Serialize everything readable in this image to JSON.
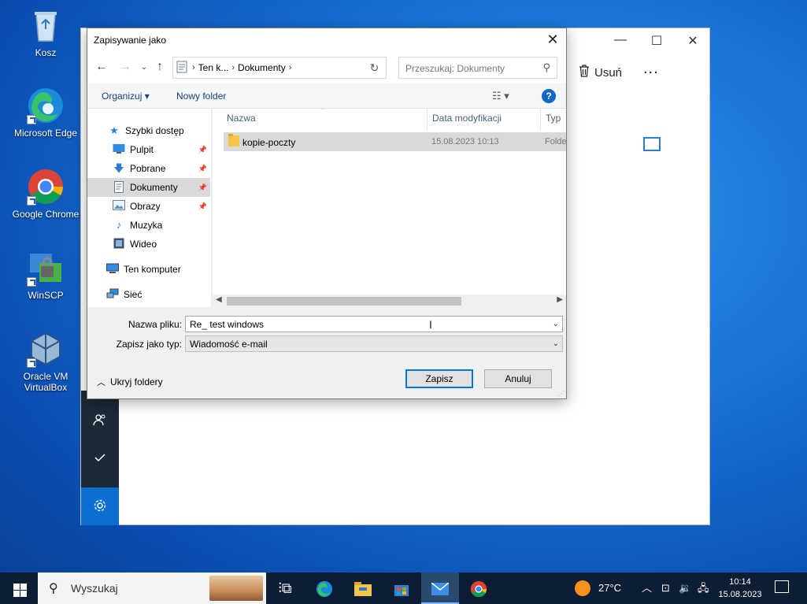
{
  "desktop": {
    "icons": [
      {
        "label": "Kosz"
      },
      {
        "label": "Microsoft Edge"
      },
      {
        "label": "Google Chrome"
      },
      {
        "label": "WinSCP"
      },
      {
        "label": "Oracle VM VirtualBox"
      }
    ]
  },
  "mail_window": {
    "delete_label": "Usuń",
    "more_label": "..."
  },
  "dialog": {
    "title": "Zapisywanie jako",
    "breadcrumb": [
      "Ten k...",
      "Dokumenty"
    ],
    "search_placeholder": "Przeszukaj: Dokumenty",
    "toolbar": {
      "organize": "Organizuj",
      "new_folder": "Nowy folder",
      "help": "?"
    },
    "nav_pane": {
      "quick_access": "Szybki dostęp",
      "items": [
        {
          "label": "Pulpit"
        },
        {
          "label": "Pobrane"
        },
        {
          "label": "Dokumenty"
        },
        {
          "label": "Obrazy"
        },
        {
          "label": "Muzyka"
        },
        {
          "label": "Wideo"
        }
      ],
      "this_pc": "Ten komputer",
      "network": "Sieć"
    },
    "columns": {
      "name": "Nazwa",
      "date": "Data modyfikacji",
      "type": "Typ"
    },
    "files": [
      {
        "name": "kopie-poczty",
        "date": "15.08.2023 10:13",
        "type": "Folde"
      }
    ],
    "filename_label": "Nazwa pliku:",
    "filename_value": "Re_ test windows",
    "filetype_label": "Zapisz jako typ:",
    "filetype_value": "Wiadomość e-mail",
    "hide_folders": "Ukryj foldery",
    "save_button": "Zapisz",
    "cancel_button": "Anuluj"
  },
  "taskbar": {
    "search_placeholder": "Wyszukaj",
    "weather": "27°C",
    "time": "10:14",
    "date": "15.08.2023"
  }
}
